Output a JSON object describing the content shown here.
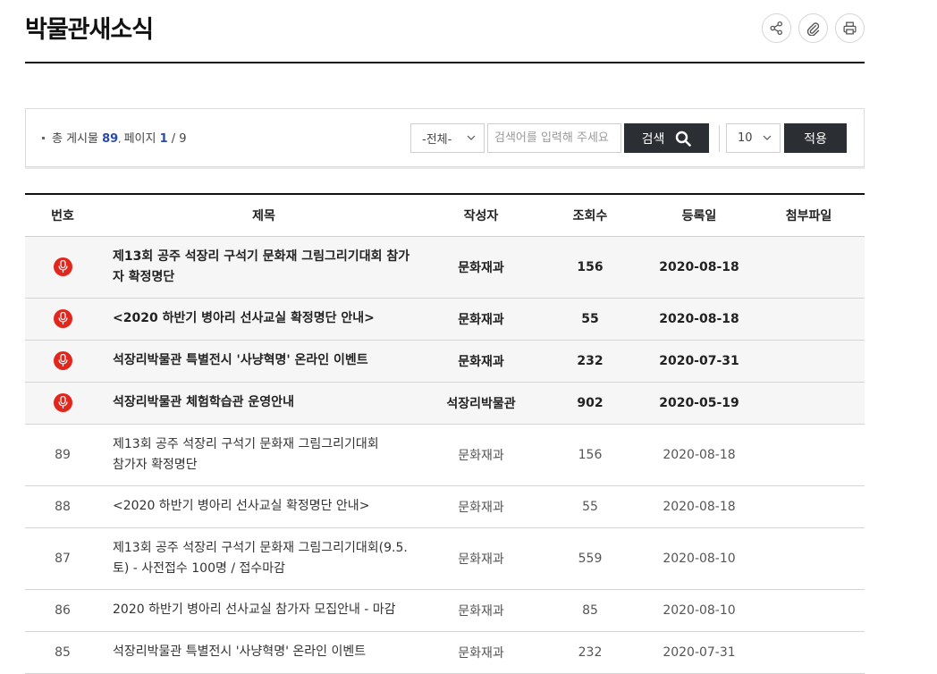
{
  "header": {
    "title": "박물관새소식",
    "tools": [
      "share-icon",
      "attach-icon",
      "print-icon"
    ]
  },
  "search": {
    "total_label": "총 게시물",
    "total_count": "89",
    "page_label": "페이지",
    "current_page": "1",
    "total_pages": "/ 9",
    "category_value": "-전체-",
    "placeholder": "검색어를 입력해 주세요",
    "search_label": "검색",
    "page_size_value": "10",
    "apply_label": "적용"
  },
  "table": {
    "columns": [
      "번호",
      "제목",
      "작성자",
      "조회수",
      "등록일",
      "첨부파일"
    ],
    "notices": [
      {
        "title_line1": "제13회 공주 석장리 구석기 문화재 그림그리기대회 참가",
        "title_line2": "자 확정명단",
        "author": "문화재과",
        "views": "156",
        "date": "2020-08-18"
      },
      {
        "title_line1": "<2020 하반기 병아리 선사교실 확정명단 안내>",
        "title_line2": "",
        "author": "문화재과",
        "views": "55",
        "date": "2020-08-18"
      },
      {
        "title_line1": "석장리박물관 특별전시 '사냥혁명' 온라인 이벤트",
        "title_line2": "",
        "author": "문화재과",
        "views": "232",
        "date": "2020-07-31"
      },
      {
        "title_line1": "석장리박물관 체험학습관 운영안내",
        "title_line2": "",
        "author": "석장리박물관",
        "views": "902",
        "date": "2020-05-19"
      }
    ],
    "rows": [
      {
        "no": "89",
        "title_line1": "제13회 공주 석장리 구석기 문화재 그림그리기대회",
        "title_line2": "참가자 확정명단",
        "author": "문화재과",
        "views": "156",
        "date": "2020-08-18"
      },
      {
        "no": "88",
        "title_line1": "<2020 하반기 병아리 선사교실 확정명단 안내>",
        "title_line2": "",
        "author": "문화재과",
        "views": "55",
        "date": "2020-08-18"
      },
      {
        "no": "87",
        "title_line1": "제13회 공주 석장리 구석기 문화재 그림그리기대회(9.5.",
        "title_line2": "토) - 사전접수 100명 / 접수마감",
        "author": "문화재과",
        "views": "559",
        "date": "2020-08-10"
      },
      {
        "no": "86",
        "title_line1": "2020 하반기 병아리 선사교실 참가자 모집안내 - 마감",
        "title_line2": "",
        "author": "문화재과",
        "views": "85",
        "date": "2020-08-10"
      },
      {
        "no": "85",
        "title_line1": "석장리박물관 특별전시 '사냥혁명' 온라인 이벤트",
        "title_line2": "",
        "author": "문화재과",
        "views": "232",
        "date": "2020-07-31"
      }
    ]
  },
  "colors": {
    "accent_blue": "#2b4aa8",
    "button_dark": "#2b2e33",
    "notice_red": "#e0271d",
    "notice_bg": "#f6f6f6"
  }
}
